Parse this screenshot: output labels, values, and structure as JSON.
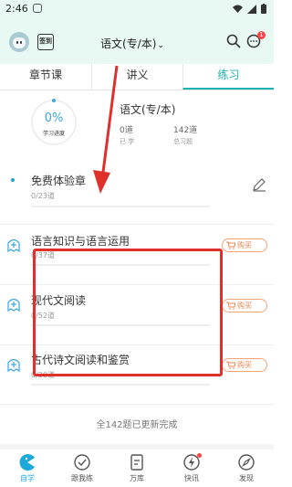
{
  "status_bar": {
    "time": "2:46"
  },
  "header": {
    "checkin_label": "签到",
    "subject": "语文(专/本)",
    "notification_count": "1"
  },
  "tabs": [
    {
      "label": "章节课",
      "active": false
    },
    {
      "label": "讲义",
      "active": false
    },
    {
      "label": "练习",
      "active": true
    }
  ],
  "summary": {
    "progress_percent": "0%",
    "progress_fraction": 0,
    "progress_label": "学习进度",
    "subject_title": "语文(专/本)",
    "done_value": "0道",
    "done_label": "已 学",
    "total_value": "142道",
    "total_label": "总习题"
  },
  "chapters": [
    {
      "title": "免费体验章",
      "count": "0/23道",
      "progress": 0,
      "action": "edit"
    },
    {
      "title": "语言知识与语言运用",
      "count": "0/37道",
      "progress": 0,
      "action": "购买"
    },
    {
      "title": "现代文阅读",
      "count": "0/52道",
      "progress": 0,
      "action": "购买"
    },
    {
      "title": "古代诗文阅读和鉴赏",
      "count": "0/30道",
      "progress": 0,
      "action": "购买"
    }
  ],
  "footer_note": "全142题已更新完成",
  "bottom_nav": [
    {
      "label": "自学",
      "icon": "pacman-icon",
      "active": true
    },
    {
      "label": "跟我练",
      "icon": "check-circle-icon",
      "active": false
    },
    {
      "label": "万库",
      "icon": "document-icon",
      "active": false
    },
    {
      "label": "快讯",
      "icon": "lightning-icon",
      "active": false,
      "dot": true
    },
    {
      "label": "发现",
      "icon": "compass-icon",
      "active": false
    }
  ],
  "colors": {
    "accent": "#1db3b1",
    "highlight": "#e0302c",
    "buy": "#e8844f",
    "nav_active": "#1aa9d8"
  }
}
